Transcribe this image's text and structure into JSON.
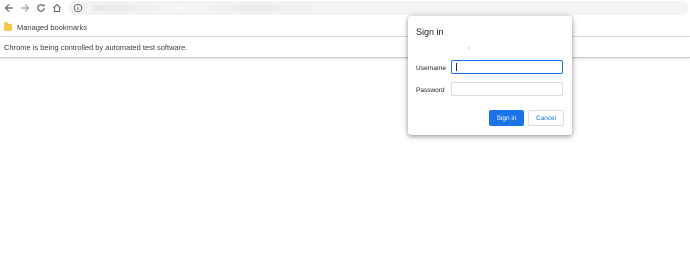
{
  "toolbar": {
    "back_icon": "arrow-left-icon",
    "forward_icon": "arrow-right-icon",
    "reload_icon": "reload-icon",
    "home_icon": "home-icon",
    "info_icon": "info-circle-icon"
  },
  "bookmarks_bar": {
    "folder_icon": "folder-icon",
    "label": "Managed bookmarks"
  },
  "infobar": {
    "message": "Chrome is being controlled by automated test software."
  },
  "dialog": {
    "title": "Sign in",
    "username_label": "Username",
    "username_value": "",
    "password_label": "Password",
    "password_value": "",
    "signin_button": "Sign in",
    "cancel_button": "Cancel"
  },
  "colors": {
    "accent": "#1a73e8",
    "folder": "#f2c94c",
    "omnibox_bg": "#f1f3f4"
  }
}
